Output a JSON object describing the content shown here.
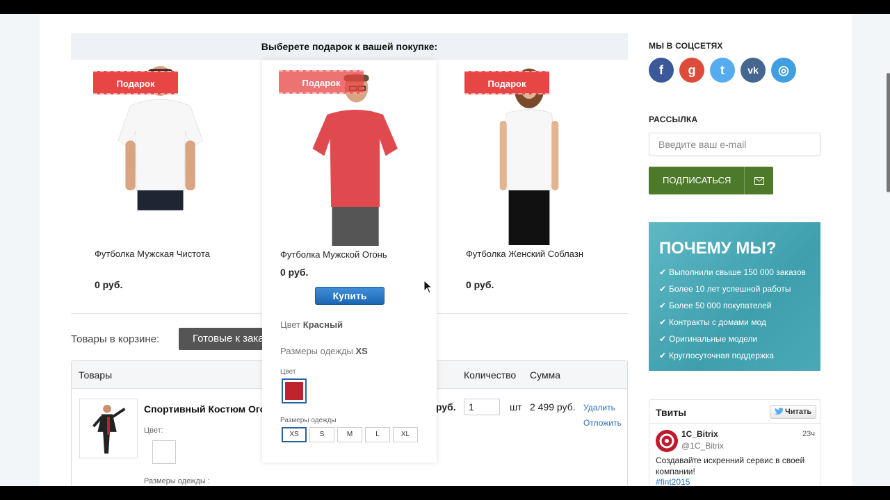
{
  "gift_section": {
    "header": "Выберете подарок к вашей покупке:",
    "badge": "Подарок",
    "items": [
      {
        "name": "Футболка Мужская Чистота",
        "price": "0 руб."
      },
      {
        "name": "Футболка Мужской Огонь",
        "price": "0 руб."
      },
      {
        "name": "Футболка Женский Соблазн",
        "price": "0 руб."
      }
    ],
    "popup": {
      "buy_label": "Купить",
      "color_prefix": "Цвет",
      "color_value": "Красный",
      "sizes_prefix": "Размеры одежды",
      "sizes_value": "XS",
      "color_label": "Цвет",
      "sizes_label": "Размеры одежды",
      "swatch_color": "#c0232d",
      "sizes": [
        "XS",
        "S",
        "M",
        "L",
        "XL"
      ],
      "selected_size": "XS"
    }
  },
  "cart": {
    "label": "Товары в корзине:",
    "ready_button": "Готовые к заказу",
    "headers": {
      "products": "Товары",
      "quantity": "Количество",
      "sum": "Сумма"
    },
    "row": {
      "name": "Спортивный Костюм Огонь",
      "color_label": "Цвет:",
      "sizes_label": "Размеры одежды :",
      "price": "руб.",
      "quantity": "1",
      "unit": "шт",
      "sum": "2 499 руб.",
      "delete": "Удалить",
      "postpone": "Отложить"
    }
  },
  "sidebar": {
    "social_title": "МЫ В СОЦСЕТЯХ",
    "social": [
      {
        "icon": "facebook-icon",
        "glyph": "f",
        "color": "#3b5998"
      },
      {
        "icon": "google-plus-icon",
        "glyph": "g",
        "color": "#dd4b39"
      },
      {
        "icon": "twitter-icon",
        "glyph": "t",
        "color": "#55acee"
      },
      {
        "icon": "vk-icon",
        "glyph": "vk",
        "color": "#45668e"
      },
      {
        "icon": "instagram-icon",
        "glyph": "◎",
        "color": "#3f9fe0"
      }
    ],
    "newsletter_title": "РАССЫЛКА",
    "email_placeholder": "Введите ваш e-mail",
    "subscribe_label": "ПОДПИСАТЬСЯ",
    "why": {
      "title": "ПОЧЕМУ МЫ?",
      "items": [
        "Выполнили свыше 150 000 заказов",
        "Более 10 лет успешной работы",
        "Более 50 000 покупателей",
        "Контракты с домами мод",
        "Оригинальные модели",
        "Круглосуточная поддержка"
      ]
    },
    "tweets": {
      "title": "Твиты",
      "follow": "Читать",
      "author": "1C_Bitrix",
      "handle": "@1C_Bitrix",
      "time": "23ч",
      "text": "Создавайте искренний сервис в своей компании!",
      "tag": "#fint2015"
    }
  }
}
